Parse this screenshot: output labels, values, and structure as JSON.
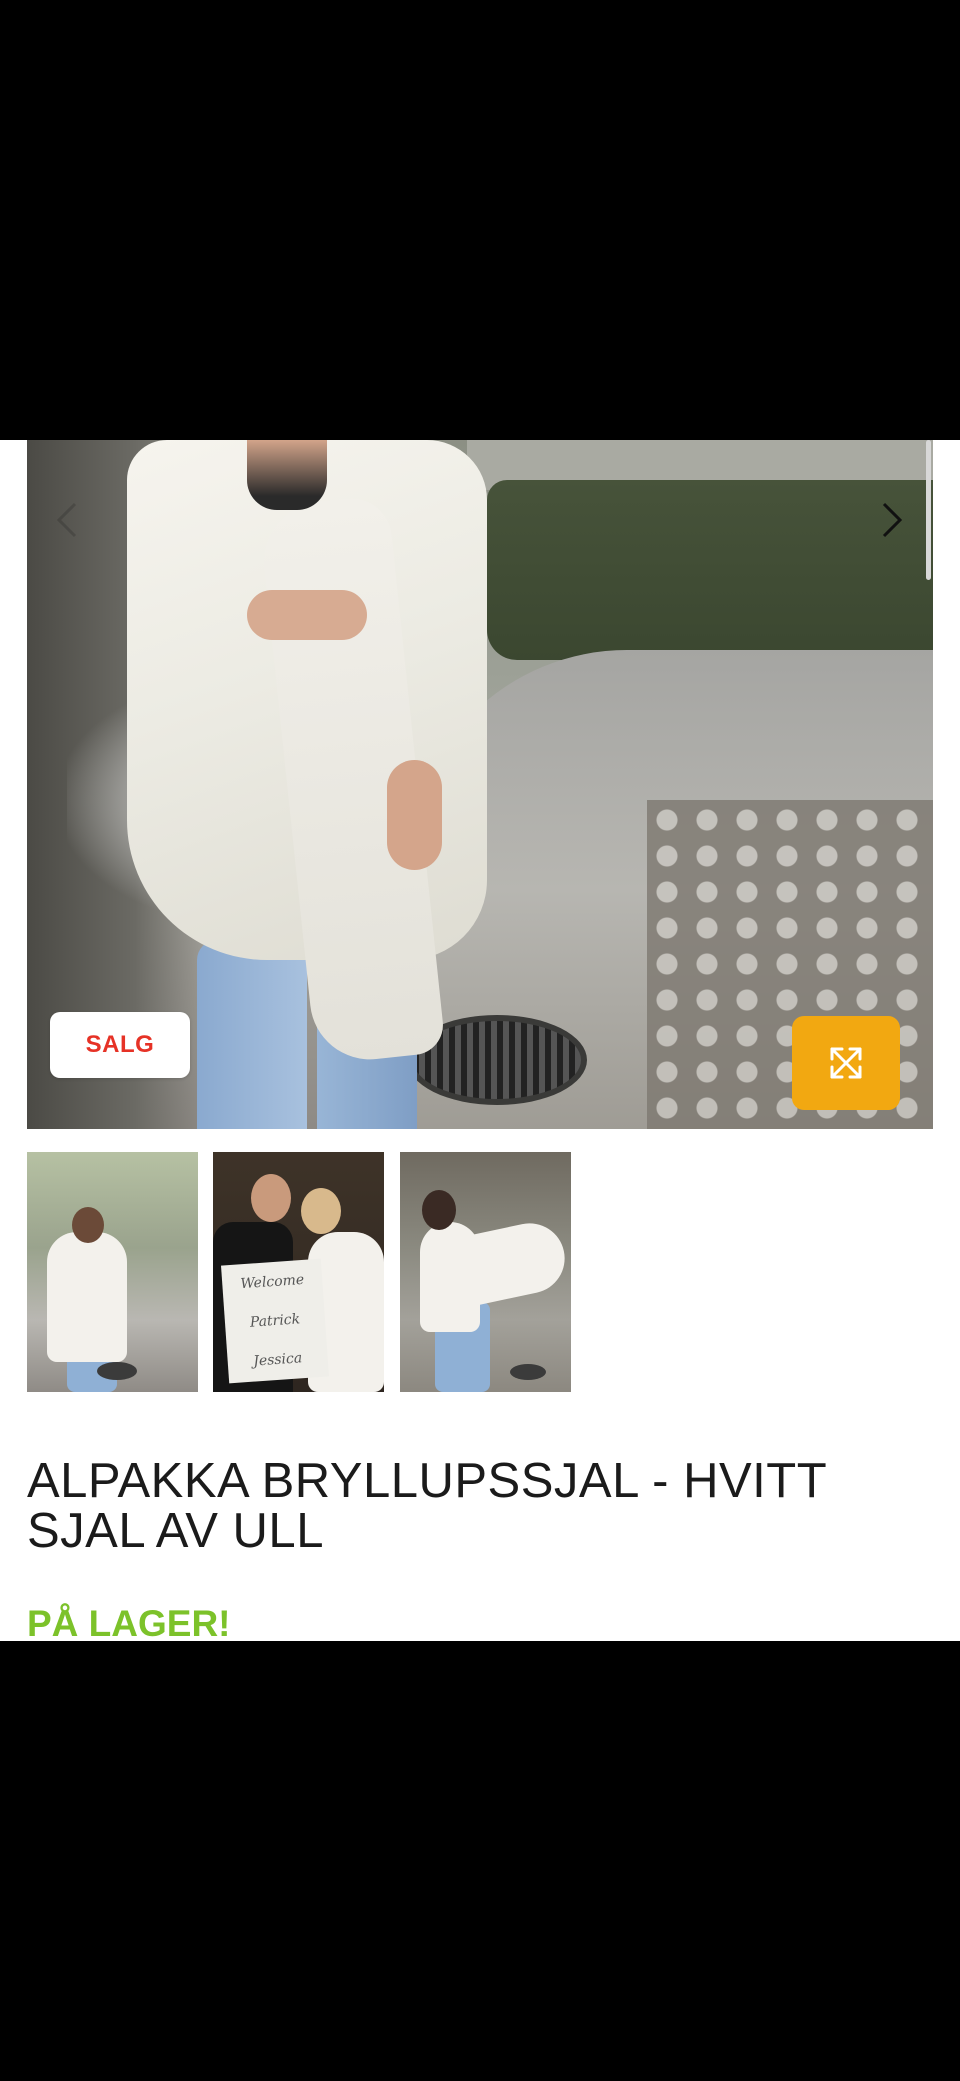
{
  "product": {
    "sale_badge": "SALG",
    "title": "ALPAKKA BRYLLUPSSJAL - HVITT SJAL AV ULL",
    "stock_status": "PÅ LAGER!"
  },
  "gallery": {
    "thumbnail_count": 3,
    "icons": {
      "prev": "chevron-left-icon",
      "next": "chevron-right-icon",
      "expand": "expand-arrows-icon"
    }
  },
  "thumbs": {
    "sign_lines": [
      "Welcome",
      "Patrick",
      "Jessica"
    ]
  },
  "colors": {
    "sale_text": "#e63226",
    "expand_button": "#f2a811",
    "stock_text": "#7cc22a",
    "title_text": "#1b1b1b"
  }
}
